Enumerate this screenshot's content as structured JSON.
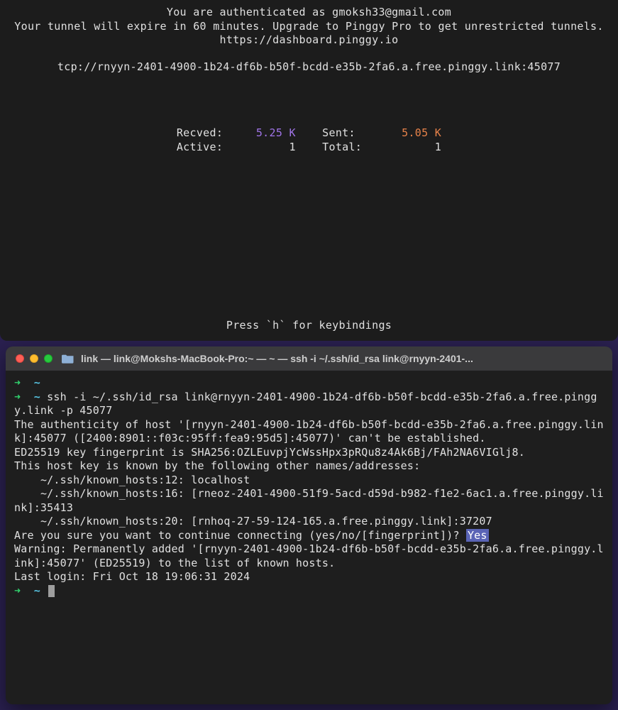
{
  "top": {
    "auth_line": "You are authenticated as gmoksh33@gmail.com",
    "expire_line": "Your tunnel will expire in 60 minutes. Upgrade to Pinggy Pro to get unrestricted tunnels.",
    "dashboard_url": "https://dashboard.pinggy.io",
    "tunnel_url": "tcp://rnyyn-2401-4900-1b24-df6b-b50f-bcdd-e35b-2fa6.a.free.pinggy.link:45077",
    "stats": {
      "recved_label": "Recved:",
      "recved_value": "5.25 K",
      "sent_label": "Sent:",
      "sent_value": "5.05 K",
      "active_label": "Active:",
      "active_value": "1",
      "total_label": "Total:",
      "total_value": "1"
    },
    "keybind_hint": "Press `h` for keybindings"
  },
  "bottom": {
    "window_title": "link — link@Mokshs-MacBook-Pro:~ — ~ — ssh -i ~/.ssh/id_rsa link@rnyyn-2401-...",
    "prompt_arrow": "➜",
    "prompt_tilde": "~",
    "ssh_command": "ssh -i ~/.ssh/id_rsa link@rnyyn-2401-4900-1b24-df6b-b50f-bcdd-e35b-2fa6.a.free.pinggy.link -p 45077",
    "authenticity_line": "The authenticity of host '[rnyyn-2401-4900-1b24-df6b-b50f-bcdd-e35b-2fa6.a.free.pinggy.link]:45077 ([2400:8901::f03c:95ff:fea9:95d5]:45077)' can't be established.",
    "fingerprint_line": "ED25519 key fingerprint is SHA256:OZLEuvpjYcWssHpx3pRQu8z4Ak6Bj/FAh2NA6VIGlj8.",
    "known_intro": "This host key is known by the following other names/addresses:",
    "known_hosts": [
      "    ~/.ssh/known_hosts:12: localhost",
      "    ~/.ssh/known_hosts:16: [rneoz-2401-4900-51f9-5acd-d59d-b982-f1e2-6ac1.a.free.pinggy.link]:35413",
      "    ~/.ssh/known_hosts:20: [rnhoq-27-59-124-165.a.free.pinggy.link]:37207"
    ],
    "confirm_prompt": "Are you sure you want to continue connecting (yes/no/[fingerprint])? ",
    "confirm_answer": "Yes",
    "warning_line": "Warning: Permanently added '[rnyyn-2401-4900-1b24-df6b-b50f-bcdd-e35b-2fa6.a.free.pinggy.link]:45077' (ED25519) to the list of known hosts.",
    "last_login": "Last login: Fri Oct 18 19:06:31 2024"
  }
}
